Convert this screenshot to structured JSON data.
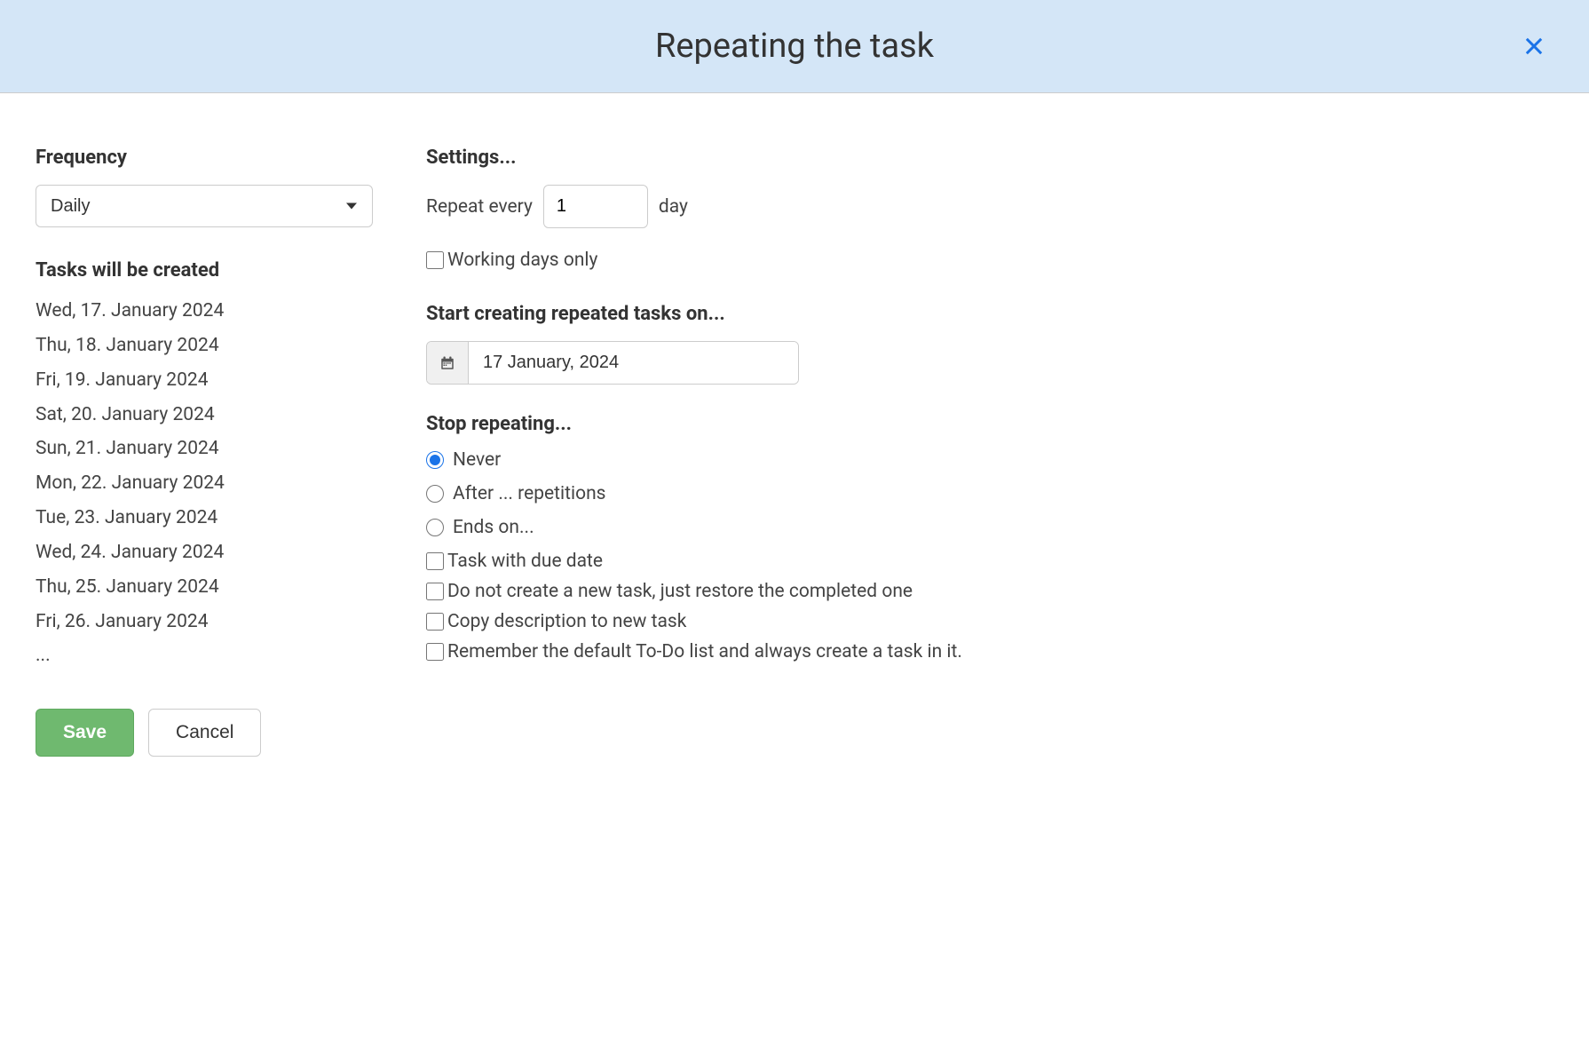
{
  "header": {
    "title": "Repeating the task"
  },
  "frequency": {
    "heading": "Frequency",
    "selected": "Daily"
  },
  "tasks_preview": {
    "heading": "Tasks will be created",
    "items": [
      "Wed, 17. January 2024",
      "Thu, 18. January 2024",
      "Fri, 19. January 2024",
      "Sat, 20. January 2024",
      "Sun, 21. January 2024",
      "Mon, 22. January 2024",
      "Tue, 23. January 2024",
      "Wed, 24. January 2024",
      "Thu, 25. January 2024",
      "Fri, 26. January 2024"
    ],
    "more": "..."
  },
  "settings": {
    "heading": "Settings...",
    "repeat_prefix": "Repeat every",
    "repeat_value": "1",
    "repeat_suffix": "day",
    "working_days_label": "Working days only",
    "working_days_checked": false
  },
  "start": {
    "heading": "Start creating repeated tasks on...",
    "value": "17 January, 2024"
  },
  "stop": {
    "heading": "Stop repeating...",
    "options": {
      "never": "Never",
      "after": "After ... repetitions",
      "ends_on": "Ends on..."
    },
    "selected": "never",
    "checkboxes": {
      "due_date": "Task with due date",
      "restore": "Do not create a new task, just restore the completed one",
      "copy_desc": "Copy description to new task",
      "remember_list": "Remember the default To-Do list and always create a task in it."
    }
  },
  "footer": {
    "save": "Save",
    "cancel": "Cancel"
  }
}
